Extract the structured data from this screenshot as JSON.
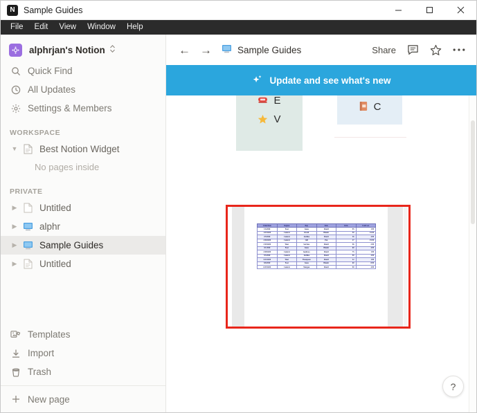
{
  "window": {
    "title": "Sample Guides",
    "app_icon": "notion-logo-icon",
    "minimize": "–",
    "maximize": "□",
    "close": "✕"
  },
  "menubar": {
    "items": [
      {
        "label": "File"
      },
      {
        "label": "Edit"
      },
      {
        "label": "View"
      },
      {
        "label": "Window"
      },
      {
        "label": "Help"
      }
    ]
  },
  "sidebar": {
    "workspace": {
      "name": "alphrjan's Notion",
      "chevron": "⌃⌄"
    },
    "nav": [
      {
        "label": "Quick Find",
        "icon": "search-icon"
      },
      {
        "label": "All Updates",
        "icon": "clock-icon"
      },
      {
        "label": "Settings & Members",
        "icon": "gear-icon"
      }
    ],
    "workspace_section": {
      "header": "WORKSPACE",
      "pages": [
        {
          "label": "Best Notion Widget",
          "icon": "page-icon",
          "expanded": true,
          "triangle": "▼"
        }
      ],
      "empty_note": "No pages inside"
    },
    "private_section": {
      "header": "PRIVATE",
      "pages": [
        {
          "label": "Untitled",
          "icon": "blank-page-icon",
          "triangle": "▶",
          "selected": false
        },
        {
          "label": "alphr",
          "icon": "computer-emoji",
          "triangle": "▶",
          "selected": false
        },
        {
          "label": "Sample Guides",
          "icon": "computer-emoji",
          "triangle": "▶",
          "selected": true
        },
        {
          "label": "Untitled",
          "icon": "lined-page-icon",
          "triangle": "▶",
          "selected": false
        }
      ]
    },
    "bottom": [
      {
        "label": "Templates",
        "icon": "templates-icon"
      },
      {
        "label": "Import",
        "icon": "import-icon"
      },
      {
        "label": "Trash",
        "icon": "trash-icon"
      }
    ],
    "new_page": {
      "label": "New page",
      "icon": "plus-icon"
    }
  },
  "topbar": {
    "back": "←",
    "forward": "→",
    "breadcrumb_icon": "computer-emoji",
    "breadcrumb": "Sample Guides",
    "share_label": "Share",
    "comment_icon": "comment-icon",
    "favorite_icon": "star-icon",
    "more_icon": "ellipsis-icon"
  },
  "banner": {
    "text": "Update and see what's new",
    "icon": "sparkle-icon",
    "color": "#2ba6dd"
  },
  "content": {
    "cards": [
      {
        "background": "#dfeae6",
        "rows": [
          {
            "emoji": "☎",
            "letter": "E"
          },
          {
            "emoji": "★",
            "letter": "V"
          }
        ]
      },
      {
        "background": "#e4eef6",
        "rows": [
          {
            "emoji": "📕",
            "letter": "C"
          }
        ]
      }
    ],
    "embedded_image": {
      "annotation_color": "#e8261b",
      "type": "spreadsheet-screenshot",
      "columns": [
        "OrderDate",
        "Region",
        "Rep",
        "Item",
        "Units",
        "UnitCost"
      ],
      "rows": [
        [
          "1/6/2020",
          "East",
          "Jones",
          "Pencil",
          "95",
          "1.99"
        ],
        [
          "1/23/2020",
          "Central",
          "Kivell",
          "Binder",
          "50",
          "19.99"
        ],
        [
          "2/9/2020",
          "Central",
          "Jardine",
          "Pencil",
          "36",
          "4.99"
        ],
        [
          "2/26/2020",
          "Central",
          "Gill",
          "Pen",
          "27",
          "19.99"
        ],
        [
          "3/15/2020",
          "West",
          "Sorvino",
          "Pencil",
          "56",
          "2.99"
        ],
        [
          "4/1/2020",
          "East",
          "Jones",
          "Binder",
          "60",
          "4.99"
        ],
        [
          "4/18/2020",
          "Central",
          "Andrews",
          "Pencil",
          "75",
          "1.99"
        ],
        [
          "5/5/2020",
          "Central",
          "Jardine",
          "Pencil",
          "90",
          "4.99"
        ],
        [
          "5/22/2020",
          "West",
          "Thompson",
          "Pencil",
          "32",
          "1.99"
        ],
        [
          "6/8/2020",
          "East",
          "Jones",
          "Binder",
          "60",
          "8.99"
        ],
        [
          "6/25/2020",
          "Central",
          "Morgan",
          "Pencil",
          "90",
          "4.99"
        ]
      ]
    },
    "help_button": "?"
  }
}
